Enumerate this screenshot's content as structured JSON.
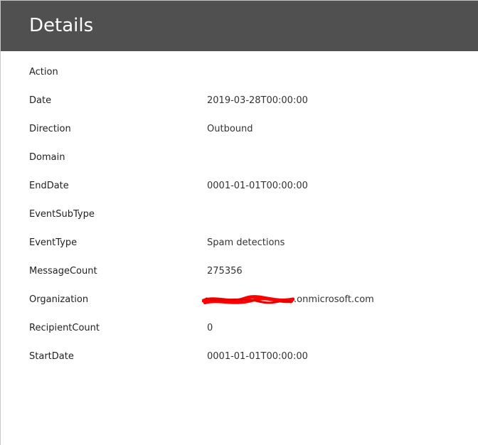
{
  "panel": {
    "title": "Details",
    "fields": [
      {
        "label": "Action",
        "value": ""
      },
      {
        "label": "Date",
        "value": "2019-03-28T00:00:00"
      },
      {
        "label": "Direction",
        "value": "Outbound"
      },
      {
        "label": "Domain",
        "value": ""
      },
      {
        "label": "EndDate",
        "value": "0001-01-01T00:00:00"
      },
      {
        "label": "EventSubType",
        "value": ""
      },
      {
        "label": "EventType",
        "value": "Spam detections"
      },
      {
        "label": "MessageCount",
        "value": "275356"
      },
      {
        "label": "Organization",
        "value": ".onmicrosoft.com"
      },
      {
        "label": "RecipientCount",
        "value": "0"
      },
      {
        "label": "StartDate",
        "value": "0001-01-01T00:00:00"
      }
    ]
  },
  "colors": {
    "header_bg": "#505050",
    "redaction": "#ff0000"
  }
}
